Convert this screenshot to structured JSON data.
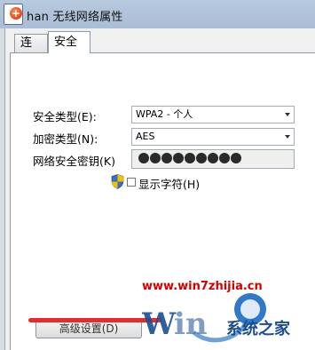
{
  "window": {
    "title": "han 无线网络属性"
  },
  "tabs": [
    {
      "label": "连接"
    },
    {
      "label": "安全"
    }
  ],
  "security_type": {
    "label": "安全类型(E):",
    "value": "WPA2 - 个人"
  },
  "encryption_type": {
    "label": "加密类型(N):",
    "value": "AES"
  },
  "network_key": {
    "label": "网络安全密钥(K)",
    "masked_length": 9
  },
  "show_characters": {
    "label": "显示字符(H)",
    "checked": false
  },
  "advanced_button": {
    "label": "高级设置(D)"
  },
  "watermark": {
    "url": "www.win7zhijia.cn",
    "brand": "系统之家"
  },
  "colors": {
    "annotation_red": "#e0302d",
    "watermark_red": "#d40000",
    "watermark_blue": "#1c4d8f"
  }
}
